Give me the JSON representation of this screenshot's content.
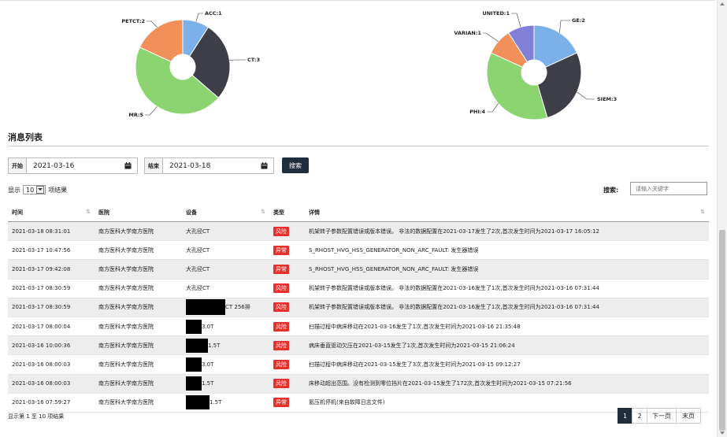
{
  "chart_data": [
    {
      "type": "pie",
      "categories": [
        "ACC",
        "CT",
        "MR",
        "PETCT"
      ],
      "values": [
        1,
        3,
        5,
        2
      ],
      "labels": [
        "ACC:1",
        "CT:3",
        "MR:5",
        "PETCT:2"
      ],
      "colors": [
        "#7cb0e8",
        "#3d3e48",
        "#8bd46f",
        "#f29059"
      ]
    },
    {
      "type": "pie",
      "categories": [
        "GE",
        "SIEM",
        "PHI",
        "VARIAN",
        "UNITED"
      ],
      "values": [
        2,
        3,
        4,
        1,
        1
      ],
      "labels": [
        "GE:2",
        "SIEM:3",
        "PHI:4",
        "VARIAN:1",
        "UNITED:1"
      ],
      "colors": [
        "#7cb0e8",
        "#3d3e48",
        "#8bd46f",
        "#f29059",
        "#8080d8"
      ]
    }
  ],
  "section_title": "消息列表",
  "filters": {
    "start_label": "开始",
    "start_value": "2021-03-16",
    "end_label": "结束",
    "end_value": "2021-03-18",
    "search_button": "搜索",
    "calendar_icon": "calendar-icon"
  },
  "length_menu": {
    "prefix": "显示",
    "value": "10",
    "suffix": "项结果"
  },
  "search": {
    "label": "搜索:",
    "placeholder": "请输入关键字"
  },
  "table": {
    "columns": [
      "时间",
      "医院",
      "设备",
      "类型",
      "详情"
    ],
    "type_colors": {
      "风险": "#e8302b",
      "异常": "#e8302b"
    },
    "rows": [
      {
        "time": "2021-03-18 08:31:01",
        "hospital": "南方医科大学南方医院",
        "device": "大孔径CT",
        "redact": 0,
        "type": "风险",
        "detail": "机架转子参数配置错误或版本错误。 非法的数据配置在2021-03-17发生了2次,首次发生时间为2021-03-17 16:05:12"
      },
      {
        "time": "2021-03-17 10:47:56",
        "hospital": "南方医科大学南方医院",
        "device": "大孔径CT",
        "redact": 0,
        "type": "异常",
        "detail": "S_RHOST_HVG_HSS_GENERATOR_NON_ARC_FAULT: 发生器错误"
      },
      {
        "time": "2021-03-17 09:42:08",
        "hospital": "南方医科大学南方医院",
        "device": "大孔径CT",
        "redact": 0,
        "type": "异常",
        "detail": "S_RHOST_HVG_HSS_GENERATOR_NON_ARC_FAULT: 发生器错误"
      },
      {
        "time": "2021-03-17 08:30:59",
        "hospital": "南方医科大学南方医院",
        "device": "大孔径CT",
        "redact": 0,
        "type": "风险",
        "detail": "机架转子参数配置错误或版本错误。 非法的数据配置在2021-03-16发生了1次,首次发生时间为2021-03-16 07:31:44"
      },
      {
        "time": "2021-03-17 08:30:59",
        "hospital": "南方医科大学南方医院",
        "device": "CT 256排",
        "redact": 50,
        "type": "风险",
        "detail": "机架转子参数配置错误或版本错误。 非法的数据配置在2021-03-16发生了1次,首次发生时间为2021-03-16 07:31:44"
      },
      {
        "time": "2021-03-17 08:00:04",
        "hospital": "南方医科大学南方医院",
        "device": "3.0T",
        "redact": 20,
        "type": "风险",
        "detail": "扫描过程中病床移动在2021-03-16发生了1次,首次发生时间为2021-03-16 21:35:48"
      },
      {
        "time": "2021-03-16 10:00:36",
        "hospital": "南方医科大学南方医院",
        "device": "1.5T",
        "redact": 28,
        "type": "风险",
        "detail": "病床垂直驱动欠压在2021-03-15发生了1次,首次发生时间为2021-03-15 21:06:24"
      },
      {
        "time": "2021-03-16 08:00:03",
        "hospital": "南方医科大学南方医院",
        "device": "3.0T",
        "redact": 20,
        "type": "风险",
        "detail": "扫描过程中病床移动在2021-03-15发生了3次,首次发生时间为2021-03-15 09:12:27"
      },
      {
        "time": "2021-03-16 08:00:03",
        "hospital": "南方医科大学南方医院",
        "device": "1.5T",
        "redact": 20,
        "type": "风险",
        "detail": "床移动超出范围。没有检测到零位挡片在2021-03-15发生了172次,首次发生时间为2021-03-15 07:21:56"
      },
      {
        "time": "2021-03-16 07:59:27",
        "hospital": "南方医科大学南方医院",
        "device": "1.5T",
        "redact": 30,
        "type": "异常",
        "detail": "氦压机停机(来自故障日志文件)"
      }
    ]
  },
  "info_text": "显示第 1 至 10 项结果",
  "pagination": {
    "pages": [
      "1",
      "2"
    ],
    "next": "下一页",
    "last": "末页",
    "active": "1",
    "active_color": "#1f2d3d"
  }
}
